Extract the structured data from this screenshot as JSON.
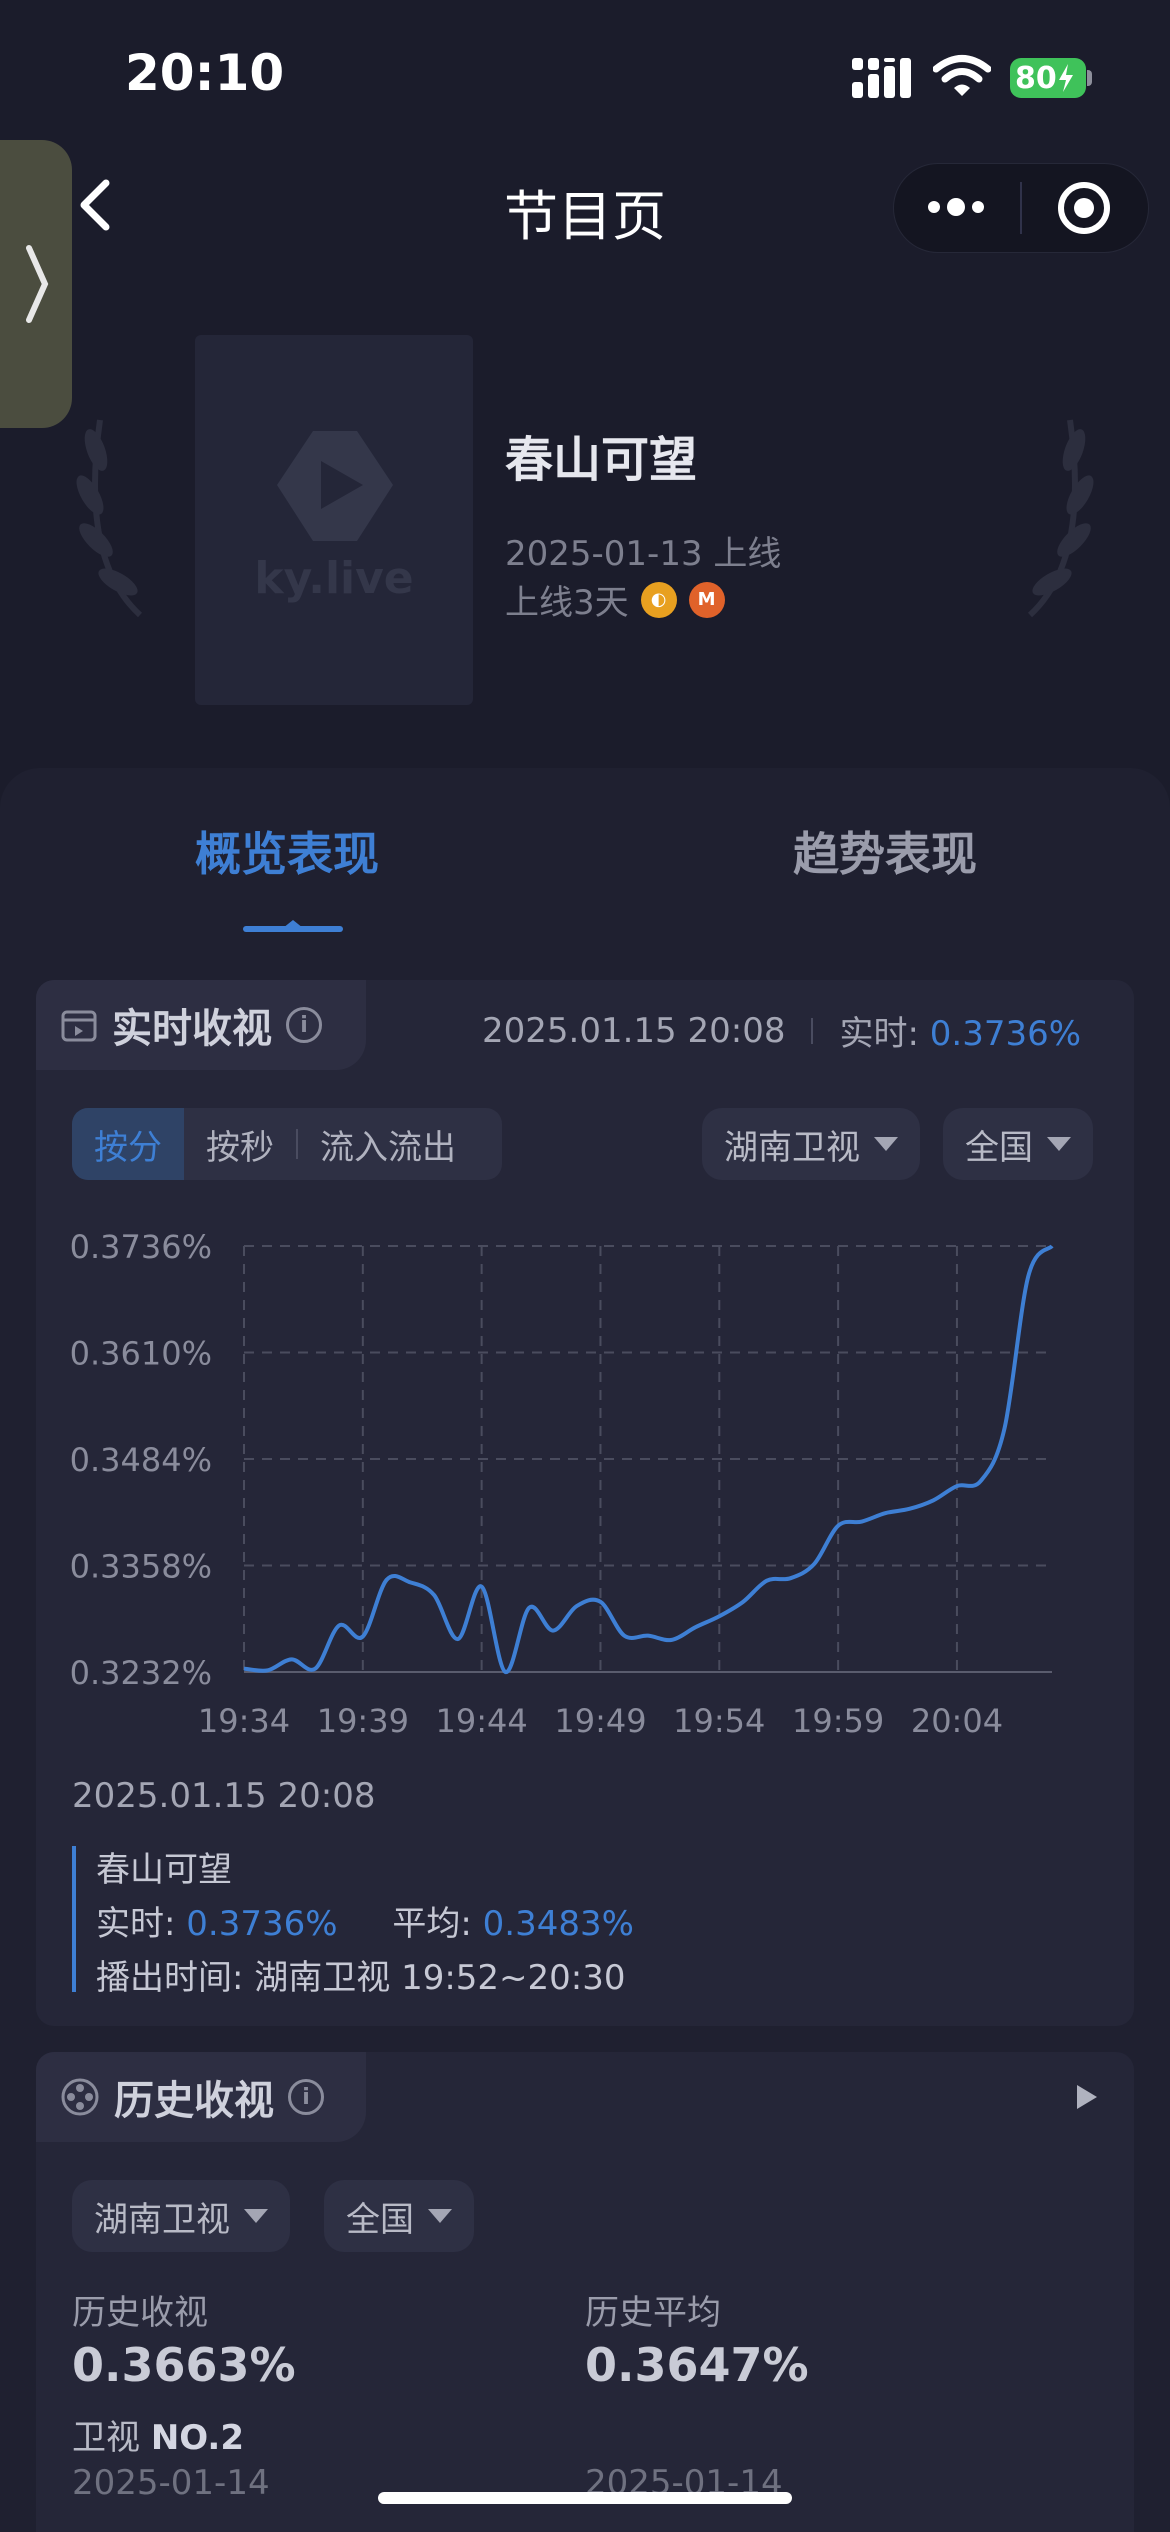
{
  "status_bar": {
    "time": "20:10",
    "battery": "80"
  },
  "nav": {
    "title": "节目页"
  },
  "show": {
    "poster_watermark": "ky.live",
    "title": "春山可望",
    "online_date": "2025-01-13 上线",
    "online_days": "上线3天"
  },
  "tabs": [
    {
      "label": "概览表现"
    },
    {
      "label": "趋势表现"
    }
  ],
  "realtime": {
    "title": "实时收视",
    "timestamp": "2025.01.15 20:08",
    "live_label": "实时:",
    "live_value": "0.3736%",
    "modes": [
      "按分",
      "按秒",
      "流入流出"
    ],
    "channel": "湖南卫视",
    "region": "全国"
  },
  "chart_data": {
    "type": "line",
    "x": [
      "19:34",
      "19:35",
      "19:36",
      "19:37",
      "19:38",
      "19:39",
      "19:40",
      "19:41",
      "19:42",
      "19:43",
      "19:44",
      "19:45",
      "19:46",
      "19:47",
      "19:48",
      "19:49",
      "19:50",
      "19:51",
      "19:52",
      "19:53",
      "19:54",
      "19:55",
      "19:56",
      "19:57",
      "19:58",
      "19:59",
      "20:00",
      "20:01",
      "20:02",
      "20:03",
      "20:04",
      "20:05",
      "20:06",
      "20:07",
      "20:08"
    ],
    "series": [
      {
        "name": "春山可望",
        "values": [
          0.3236,
          0.3234,
          0.3247,
          0.3236,
          0.3287,
          0.3274,
          0.3341,
          0.3338,
          0.3323,
          0.3271,
          0.3333,
          0.3232,
          0.3308,
          0.3281,
          0.331,
          0.3315,
          0.3275,
          0.3275,
          0.327,
          0.3285,
          0.3298,
          0.3315,
          0.334,
          0.3343,
          0.336,
          0.3405,
          0.341,
          0.342,
          0.3425,
          0.3435,
          0.3452,
          0.3458,
          0.352,
          0.37,
          0.3736
        ]
      }
    ],
    "x_ticks": [
      "19:34",
      "19:39",
      "19:44",
      "19:49",
      "19:54",
      "19:59",
      "20:04"
    ],
    "y_ticks": [
      "0.3232%",
      "0.3358%",
      "0.3484%",
      "0.3610%",
      "0.3736%"
    ],
    "ylim": [
      0.3232,
      0.3736
    ],
    "grid": true,
    "color": "#3e7fd4"
  },
  "tooltip": {
    "date": "2025.01.15 20:08",
    "series": "春山可望",
    "live_label": "实时:",
    "live_value": "0.3736%",
    "avg_label": "平均:",
    "avg_value": "0.3483%",
    "airtime": "播出时间: 湖南卫视 19:52~20:30"
  },
  "history": {
    "title": "历史收视",
    "channel": "湖南卫视",
    "region": "全国",
    "rating_label": "历史收视",
    "rating_value": "0.3663%",
    "rank_prefix": "卫视",
    "rank": "NO.2",
    "rating_date": "2025-01-14",
    "avg_label": "历史平均",
    "avg_value": "0.3647%",
    "avg_date": "2025-01-14"
  }
}
